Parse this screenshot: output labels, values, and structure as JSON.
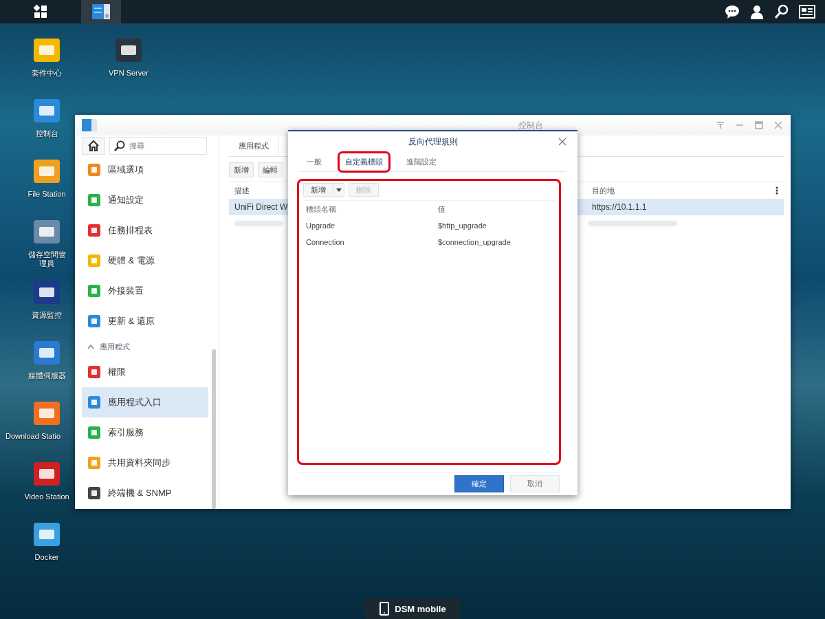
{
  "taskbar": {
    "apps": [
      {
        "kind": "main-menu",
        "selected": false
      },
      {
        "kind": "control-panel",
        "selected": true
      }
    ]
  },
  "desktop_icons": [
    {
      "label": "套件中心"
    },
    {
      "label": "控制台"
    },
    {
      "label": "File Station"
    },
    {
      "label": "儲存空間管理員"
    },
    {
      "label": "資源監控"
    },
    {
      "label": "媒體伺服器"
    },
    {
      "label": "Download Statio"
    },
    {
      "label": "Video Station"
    },
    {
      "label": "Docker"
    },
    {
      "label": "VPN Server"
    }
  ],
  "window": {
    "title": "控制台",
    "search": {
      "placeholder": "搜尋"
    },
    "sidebar": {
      "items": [
        {
          "kind": "item",
          "label": "區域選項",
          "selected": false
        },
        {
          "kind": "item",
          "label": "通知設定",
          "selected": false
        },
        {
          "kind": "item",
          "label": "任務排程表",
          "selected": false
        },
        {
          "kind": "item",
          "label": "硬體 & 電源",
          "selected": false
        },
        {
          "kind": "item",
          "label": "外接裝置",
          "selected": false
        },
        {
          "kind": "item",
          "label": "更新 & 還原",
          "selected": false
        },
        {
          "kind": "section",
          "label": "應用程式",
          "expanded": true
        },
        {
          "kind": "item",
          "label": "權限",
          "selected": false
        },
        {
          "kind": "item",
          "label": "應用程式入口",
          "selected": true
        },
        {
          "kind": "item",
          "label": "索引服務",
          "selected": false
        },
        {
          "kind": "item",
          "label": "共用資料夾同步",
          "selected": false
        },
        {
          "kind": "item",
          "label": "終端機 & SNMP",
          "selected": false
        }
      ]
    },
    "tabs": [
      {
        "label": "應用程式",
        "selected": true
      }
    ],
    "toolbar": [
      "新增",
      "編輯"
    ],
    "table": {
      "columns": [
        "描述",
        "目的地"
      ],
      "rows": [
        {
          "cells": [
            "UniFi Direct W",
            "https://10.1.1.1"
          ],
          "selected": true
        }
      ]
    }
  },
  "dialog": {
    "title": "反向代理規則",
    "tabs": [
      {
        "label": "一般",
        "selected": false,
        "highlighted": false
      },
      {
        "label": "自定義標頭",
        "selected": true,
        "highlighted": true
      },
      {
        "label": "進階設定",
        "selected": false,
        "highlighted": false
      }
    ],
    "panel": {
      "highlighted": true,
      "toolbar": [
        {
          "label": "新增",
          "kind": "split",
          "disabled": false
        },
        {
          "label": "刪除",
          "kind": "plain",
          "disabled": true
        }
      ],
      "columns": [
        "標頭名稱",
        "值"
      ],
      "rows": [
        [
          "Upgrade",
          "$http_upgrade"
        ],
        [
          "Connection",
          "$connection_upgrade"
        ]
      ]
    },
    "buttons": [
      {
        "label": "確定",
        "kind": "primary"
      },
      {
        "label": "取消",
        "kind": "secondary"
      }
    ]
  },
  "mobile_button": {
    "label": "DSM mobile"
  }
}
